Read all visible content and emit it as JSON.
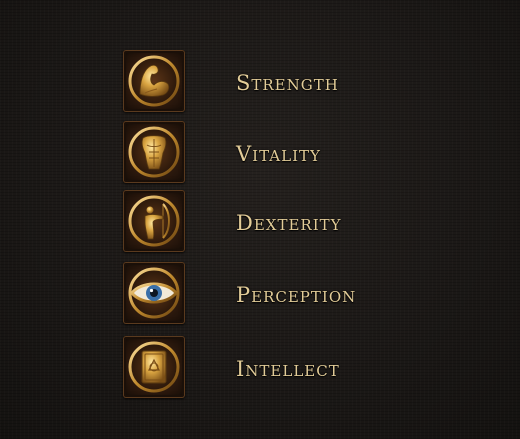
{
  "colors": {
    "background": "#1b1816",
    "label_text": "#e2cc98",
    "icon_gold": "#d9a441",
    "icon_frame": "#2e1a0e"
  },
  "attributes": [
    {
      "label": "Strength",
      "icon": "flexed-arm-icon"
    },
    {
      "label": "Vitality",
      "icon": "torso-icon"
    },
    {
      "label": "Dexterity",
      "icon": "archer-icon"
    },
    {
      "label": "Perception",
      "icon": "eye-icon"
    },
    {
      "label": "Intellect",
      "icon": "tome-icon"
    }
  ]
}
